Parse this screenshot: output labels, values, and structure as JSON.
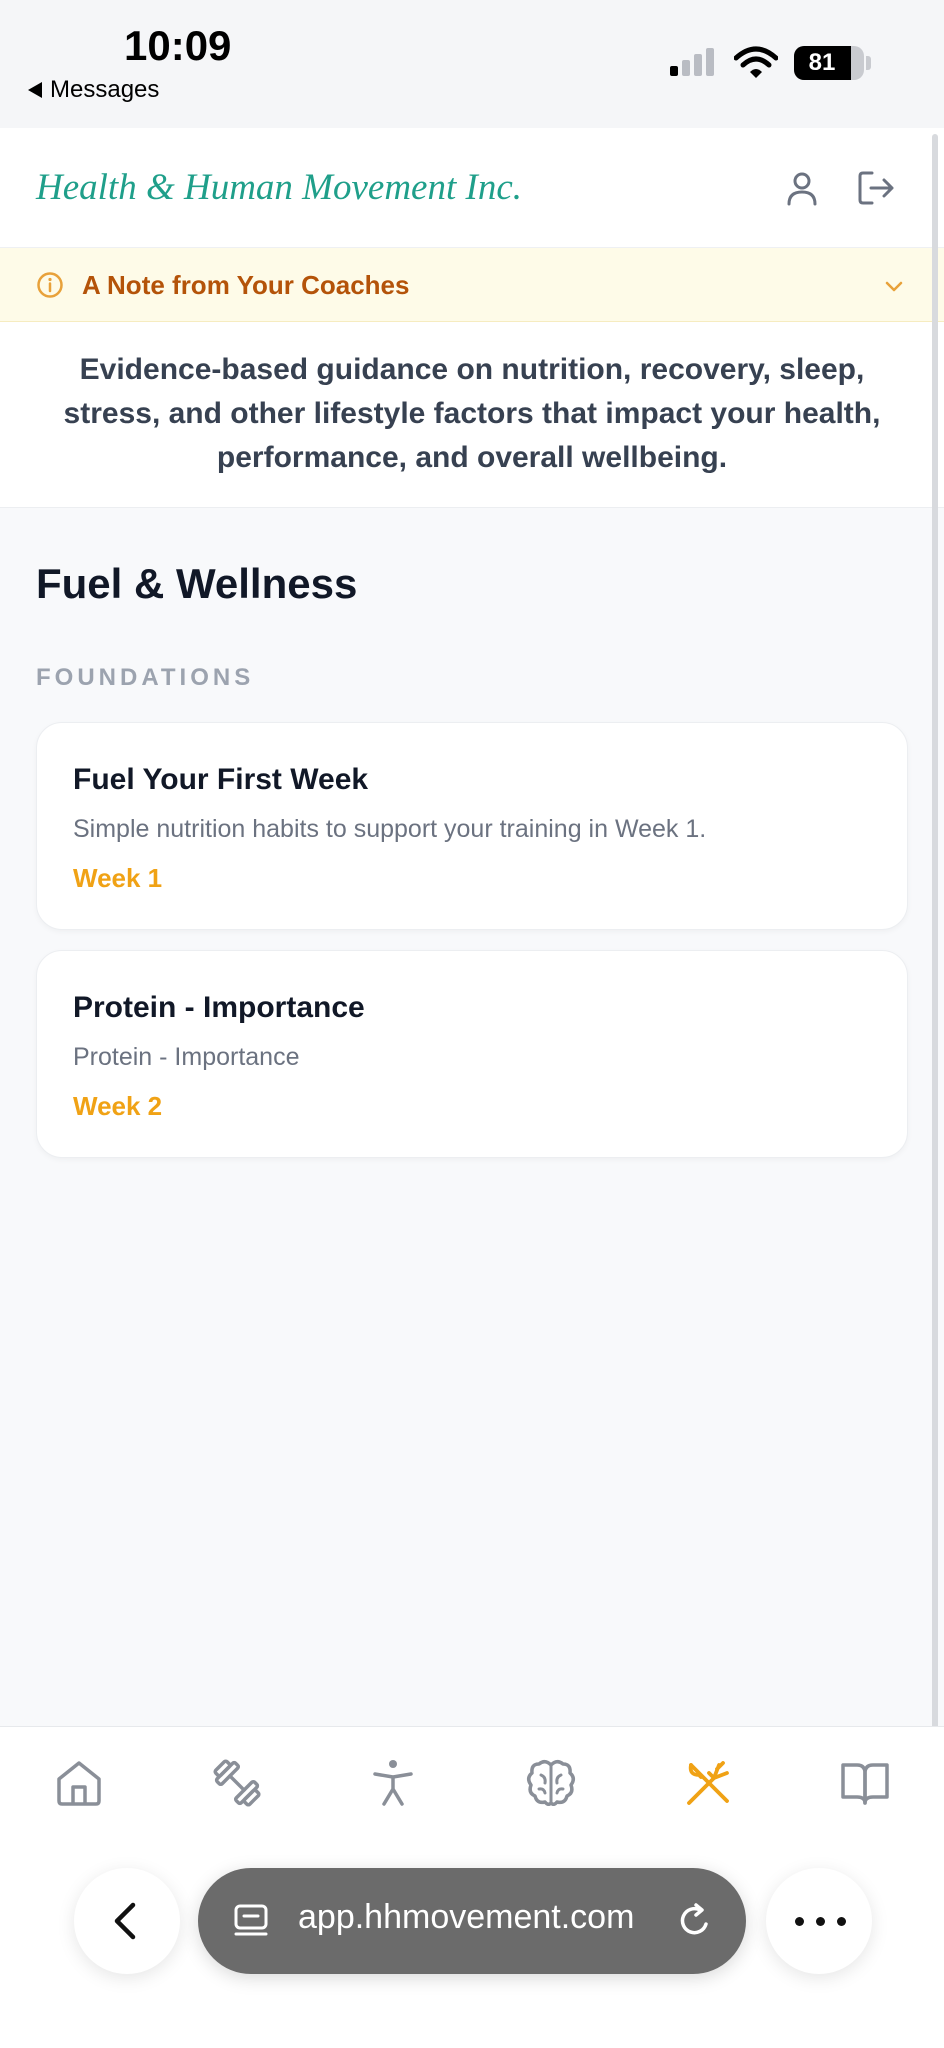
{
  "status_bar": {
    "time": "10:09",
    "back_app": "Messages",
    "battery_percent": "81",
    "battery_level": 0.81
  },
  "header": {
    "brand": "Health & Human Movement Inc.",
    "profile_icon": "user-icon",
    "logout_icon": "logout-icon"
  },
  "note_banner": {
    "label": "A Note from Your Coaches",
    "expanded": false
  },
  "intro": {
    "text": "Evidence-based guidance on nutrition, recovery, sleep, stress, and other lifestyle factors that impact your health, performance, and overall wellbeing."
  },
  "main": {
    "section_title": "Fuel & Wellness",
    "group_label": "FOUNDATIONS",
    "cards": [
      {
        "title": "Fuel Your First Week",
        "description": "Simple nutrition habits to support your training in Week 1.",
        "week": "Week 1"
      },
      {
        "title": "Protein - Importance",
        "description": "Protein - Importance",
        "week": "Week 2"
      }
    ]
  },
  "bottom_nav": {
    "items": [
      "home-icon",
      "dumbbell-icon",
      "person-icon",
      "brain-icon",
      "fork-knife-icon",
      "book-icon"
    ],
    "active": "fork-knife-icon"
  },
  "safari": {
    "url": "app.hhmovement.com"
  },
  "colors": {
    "brand_teal": "#1f9f8a",
    "accent_orange": "#f0a215",
    "note_text": "#b45309",
    "note_bg": "#fefbe8",
    "inactive_icon": "#8a8f98"
  }
}
